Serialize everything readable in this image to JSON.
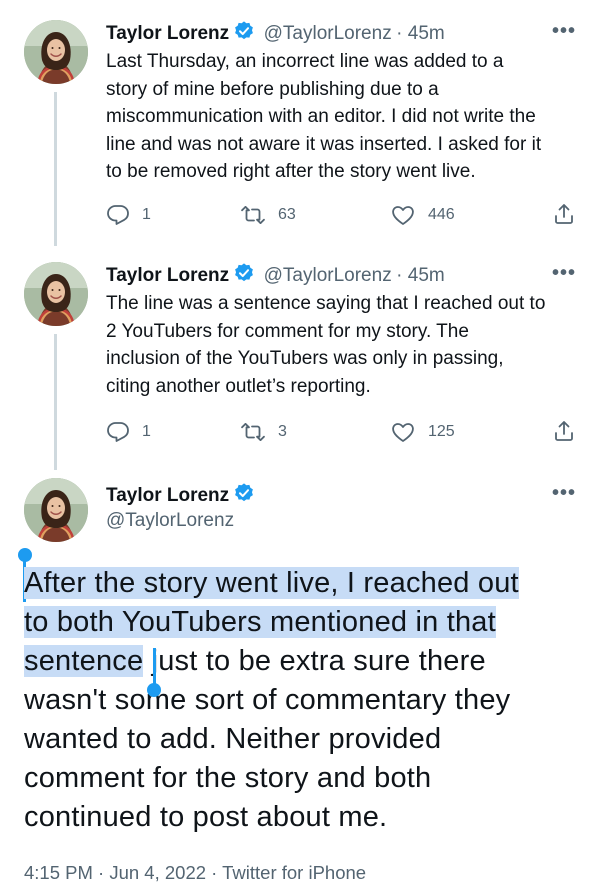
{
  "colors": {
    "accent": "#1d9bf0",
    "selection": "#c7dcf6",
    "secondary_text": "#536471"
  },
  "tweets": [
    {
      "name": "Taylor Lorenz",
      "handle": "@TaylorLorenz",
      "time": "· 45m",
      "text_lines": [
        "Last Thursday, an incorrect line was added to a",
        "story of mine before publishing due to a",
        "miscommunication with an editor. I did not write the",
        "line and was not aware it was inserted. I asked for it",
        "to be removed right after the story went live."
      ],
      "replies": "1",
      "retweets": "63",
      "likes": "446"
    },
    {
      "name": "Taylor Lorenz",
      "handle": "@TaylorLorenz",
      "time": "· 45m",
      "text_lines": [
        "The line was a sentence saying that I reached out to",
        "2 YouTubers for comment for my story. The",
        "inclusion of the YouTubers was only in passing,",
        "citing another outlet’s reporting."
      ],
      "replies": "1",
      "retweets": "3",
      "likes": "125"
    }
  ],
  "main_tweet": {
    "name": "Taylor Lorenz",
    "handle": "@TaylorLorenz",
    "line1": "After the story went live, I reached out",
    "line2": "to both YouTubers mentioned in that",
    "line3_selected": "sentence",
    "line3_rest": " just to be extra sure there",
    "line4": "wasn't some sort of commentary they",
    "line5": "wanted to add. Neither provided",
    "line6": "comment for the story and both",
    "line7": "continued to post about me.",
    "meta": "4:15 PM · Jun 4, 2022 · Twitter for iPhone"
  },
  "icons": {
    "more": "more-icon",
    "reply": "reply-icon",
    "retweet": "retweet-icon",
    "like": "heart-icon",
    "share": "share-icon",
    "verified": "verified-badge-icon"
  },
  "more_glyph": "•••"
}
